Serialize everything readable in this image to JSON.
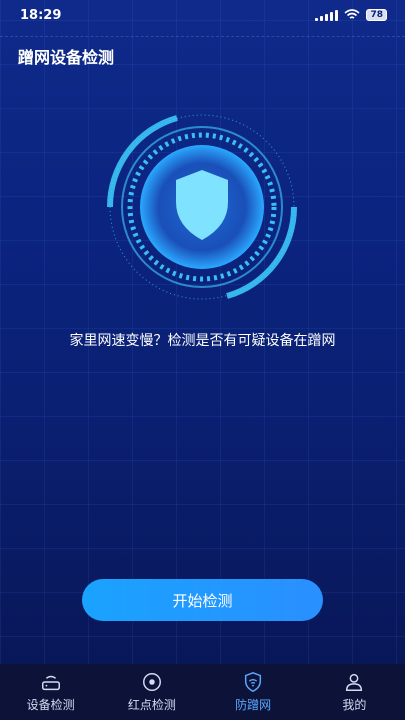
{
  "status": {
    "time": "18:29",
    "battery": "78"
  },
  "header": {
    "title": "蹭网设备检测"
  },
  "main": {
    "message": "家里网速变慢？检测是否有可疑设备在蹭网",
    "start_button": "开始检测"
  },
  "tabs": [
    {
      "label": "设备检测",
      "icon": "router-icon",
      "active": false
    },
    {
      "label": "红点检测",
      "icon": "camera-lens-icon",
      "active": false
    },
    {
      "label": "防蹭网",
      "icon": "shield-wifi-icon",
      "active": true
    },
    {
      "label": "我的",
      "icon": "user-icon",
      "active": false
    }
  ],
  "colors": {
    "accent": "#2a8fff",
    "active_tab": "#5aa8ff",
    "radar": "#3fd0ff"
  }
}
